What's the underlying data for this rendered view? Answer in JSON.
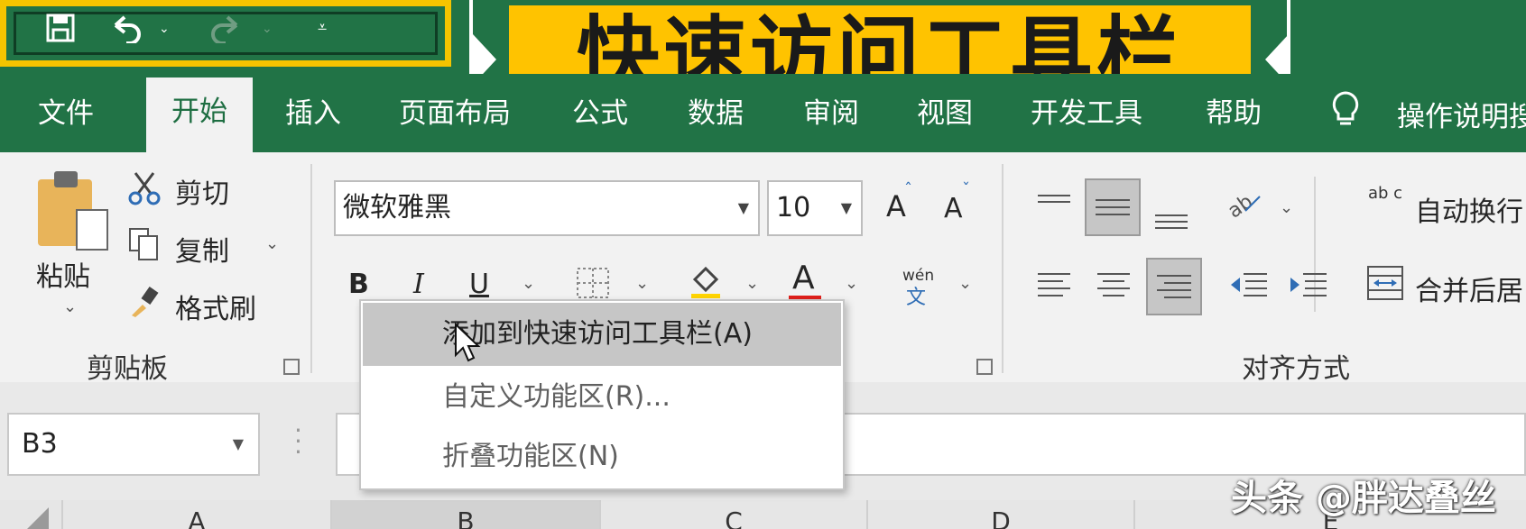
{
  "qat": {
    "save_icon": "save-icon",
    "undo_icon": "undo-icon",
    "redo_icon": "redo-icon",
    "customize_icon": "customize-qat-icon"
  },
  "banner": {
    "text": "快速访问工具栏"
  },
  "tabs": {
    "file": "文件",
    "home": "开始",
    "insert": "插入",
    "page_layout": "页面布局",
    "formulas": "公式",
    "data": "数据",
    "review": "审阅",
    "view": "视图",
    "developer": "开发工具",
    "help": "帮助"
  },
  "tell_me": "操作说明搜",
  "clipboard": {
    "cut": "剪切",
    "copy": "复制",
    "format_painter": "格式刷",
    "paste": "粘贴",
    "group_label": "剪贴板"
  },
  "font": {
    "name": "微软雅黑",
    "size": "10",
    "grow": "A",
    "shrink": "A",
    "bold": "B",
    "italic": "I",
    "underline": "U",
    "font_color": "A",
    "phonetic_top": "wén",
    "phonetic_bottom": "文"
  },
  "alignment": {
    "wrap_text": "自动换行",
    "wrap_icon_text": "ab c",
    "merge_center": "合并后居",
    "group_label": "对齐方式"
  },
  "name_box": {
    "value": "B3"
  },
  "columns": [
    "A",
    "B",
    "C",
    "D",
    "E"
  ],
  "context_menu": {
    "items": [
      {
        "label": "添加到快速访问工具栏(A)"
      },
      {
        "label": "自定义功能区(R)..."
      },
      {
        "label": "折叠功能区(N)"
      }
    ]
  },
  "watermark": "头条 @胖达叠丝"
}
